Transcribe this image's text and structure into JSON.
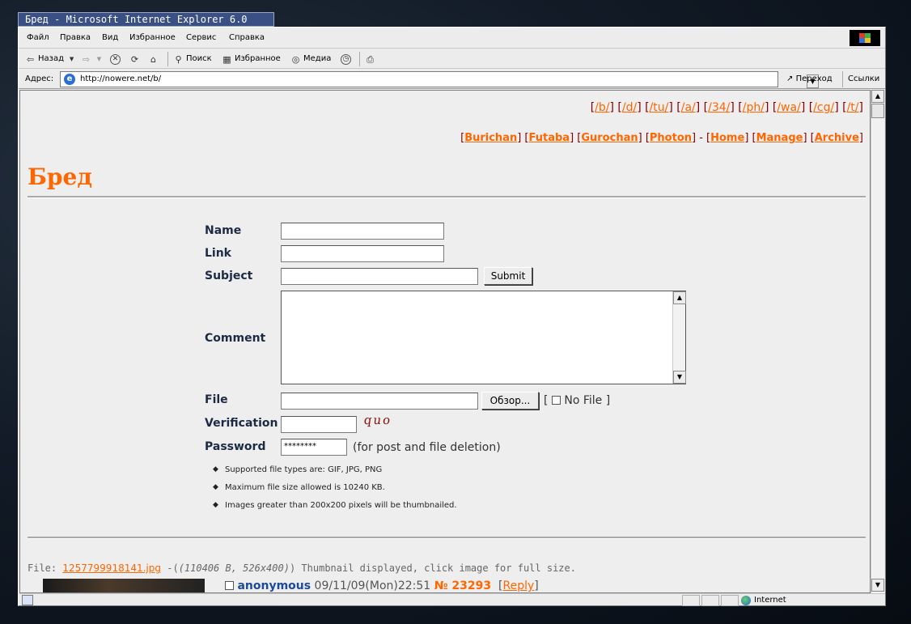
{
  "window": {
    "title": "Бред - Microsoft Internet Explorer 6.0"
  },
  "menu": [
    "Файл",
    "Правка",
    "Вид",
    "Избранное",
    "Сервис",
    "Справка"
  ],
  "toolbar": {
    "back": "Назад",
    "search": "Поиск",
    "favorites": "Избранное",
    "media": "Медиа"
  },
  "address": {
    "label": "Адрес:",
    "url": "http://nowere.net/b/",
    "go": "Переход",
    "links": "Ссылки"
  },
  "boards": [
    "/b/",
    "/d/",
    "/tu/",
    "/a/",
    "/34/",
    "/ph/",
    "/wa/",
    "/cg/",
    "/t/"
  ],
  "board_nav": {
    "burichan": "Burichan",
    "futaba": "Futaba",
    "gurochan": "Gurochan",
    "photon": "Photon",
    "home": "Home",
    "manage": "Manage",
    "archive": "Archive"
  },
  "logo": "Бред",
  "form": {
    "name_label": "Name",
    "link_label": "Link",
    "subject_label": "Subject",
    "submit": "Submit",
    "comment_label": "Comment",
    "file_label": "File",
    "browse": "Обзор...",
    "no_file": "No File",
    "verification_label": "Verification",
    "captcha": "quo",
    "password_label": "Password",
    "password_value": "********",
    "password_hint": "(for post and file deletion)"
  },
  "rules": [
    "Supported file types are: GIF, JPG, PNG",
    "Maximum file size allowed is 10240 KB.",
    "Images greater than 200x200 pixels will be thumbnailed."
  ],
  "post": {
    "file_prefix": "File:",
    "file_name": "1257799918141.jpg",
    "file_meta": "(110406 B, 526x400)",
    "file_note": "Thumbnail displayed, click image for full size.",
    "author": "anonymous",
    "date": "09/11/09(Mon)22:51",
    "number": "№ 23293",
    "reply": "Reply"
  },
  "status": {
    "zone": "Internet"
  },
  "colors": {
    "accent": "#ff6600",
    "title_bar": "#3a4f84",
    "label": "#1d2a44"
  }
}
